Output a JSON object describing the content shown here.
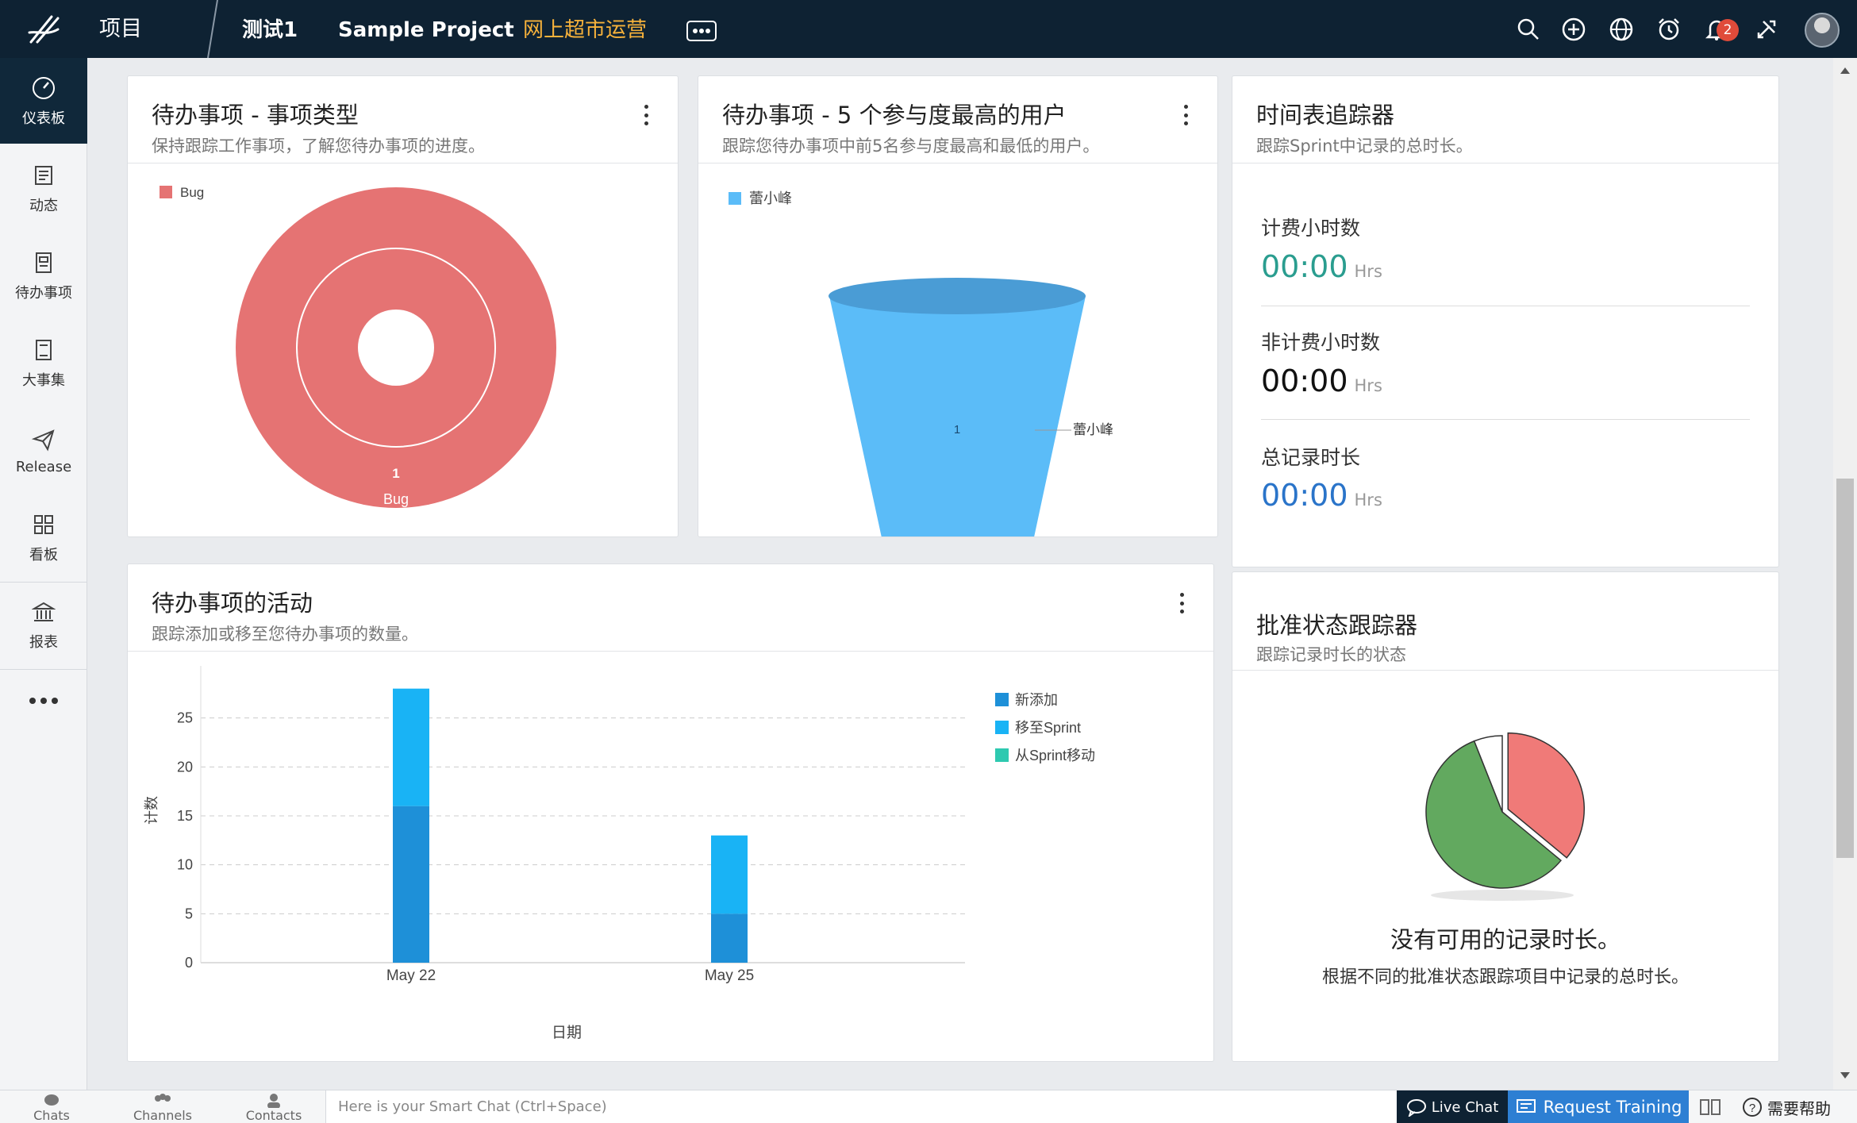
{
  "topbar": {
    "projects_label": "项目",
    "tabs": [
      "测试1",
      "Sample Project",
      "网上超市运营"
    ],
    "notification_count": "2"
  },
  "sidebar": {
    "items": [
      "仪表板",
      "动态",
      "待办事项",
      "大事集",
      "Release",
      "看板",
      "报表"
    ]
  },
  "cards": {
    "item_types": {
      "title": "待办事项 - 事项类型",
      "subtitle": "保持跟踪工作事项，了解您待办事项的进度。"
    },
    "top_users": {
      "title": "待办事项 - 5 个参与度最高的用户",
      "subtitle": "跟踪您待办事项中前5名参与度最高和最低的用户。"
    },
    "timesheet": {
      "title": "时间表追踪器",
      "subtitle": "跟踪Sprint中记录的总时长。",
      "rows": [
        {
          "label": "计费小时数",
          "value": "00:00",
          "unit": "Hrs",
          "color": "#2a9d8f"
        },
        {
          "label": "非计费小时数",
          "value": "00:00",
          "unit": "Hrs",
          "color": "#111111"
        },
        {
          "label": "总记录时长",
          "value": "00:00",
          "unit": "Hrs",
          "color": "#2a74c9"
        }
      ]
    },
    "activity": {
      "title": "待办事项的活动",
      "subtitle": "跟踪添加或移至您待办事项的数量。"
    },
    "approval": {
      "title": "批准状态跟踪器",
      "subtitle": "跟踪记录时长的状态",
      "empty_title": "没有可用的记录时长。",
      "empty_desc": "根据不同的批准状态跟踪项目中记录的总时长。"
    }
  },
  "chart_data": [
    {
      "type": "pie",
      "legend": [
        "Bug"
      ],
      "slices": [
        {
          "label": "Bug",
          "value": 1
        }
      ],
      "inner_label": "Bug",
      "value_label": "1",
      "colors": [
        "#e57373"
      ]
    },
    {
      "type": "funnel",
      "legend": [
        "蕾小峰"
      ],
      "slices": [
        {
          "label": "蕾小峰",
          "value": 1
        }
      ],
      "value_label": "1",
      "colors": [
        "#5bbcf8"
      ]
    },
    {
      "type": "bar",
      "stacked": true,
      "categories": [
        "May 22",
        "May 25"
      ],
      "series": [
        {
          "name": "新添加",
          "values": [
            16,
            5
          ],
          "color": "#1e90d8"
        },
        {
          "name": "移至Sprint",
          "values": [
            12,
            8
          ],
          "color": "#19b3f5"
        },
        {
          "name": "从Sprint移动",
          "values": [
            0,
            0
          ],
          "color": "#2ec9b0"
        }
      ],
      "xlabel": "日期",
      "ylabel": "计数",
      "ylim": [
        0,
        30
      ],
      "yticks": [
        0,
        5,
        10,
        15,
        20,
        25
      ],
      "grid": true,
      "legend_position": "top-right"
    },
    {
      "type": "pie",
      "slices": [
        {
          "value": 36,
          "color": "#f07a78"
        },
        {
          "value": 58,
          "color": "#62a95f"
        },
        {
          "value": 6,
          "color": "#ffffff"
        }
      ]
    }
  ],
  "bottombar": {
    "items": [
      "Chats",
      "Channels",
      "Contacts"
    ],
    "smart_chat_placeholder": "Here is your Smart Chat (Ctrl+Space)",
    "live_chat": "Live Chat",
    "request_training": "Request Training",
    "help": "需要帮助"
  }
}
